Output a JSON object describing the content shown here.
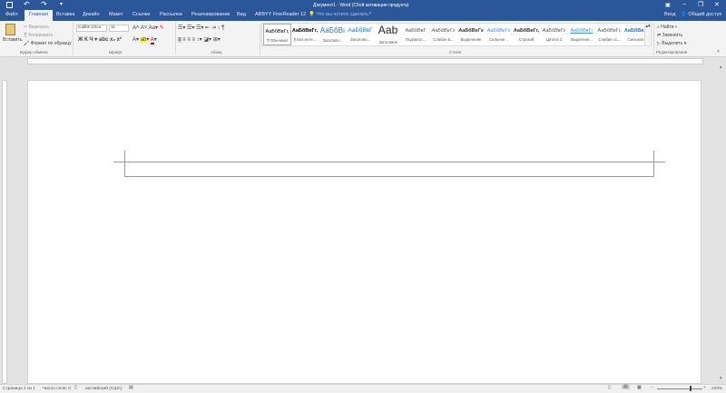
{
  "title": "Документ1 - Word (Сбой активации продукта)",
  "window": {
    "signin": "Вход",
    "share": "Общий доступ"
  },
  "tabs": [
    "Файл",
    "Главная",
    "Вставка",
    "Дизайн",
    "Макет",
    "Ссылки",
    "Рассылки",
    "Рецензирование",
    "Вид",
    "ABBYY FineReader 12"
  ],
  "tell_me": "Что вы хотите сделать?",
  "clipboard": {
    "paste": "Вставить",
    "cut": "Вырезать",
    "copy": "Копировать",
    "format_painter": "Формат по образцу",
    "label": "Буфер обмена"
  },
  "font": {
    "name": "Calibri (Осн",
    "size": "11",
    "label": "Шрифт"
  },
  "paragraph": {
    "label": "Абзац"
  },
  "styles": {
    "label": "Стили",
    "items": [
      {
        "preview": "АаБбВвГг,",
        "name": "¶ Обычный"
      },
      {
        "preview": "АаБбВвГг,",
        "name": "¶ Без инте..."
      },
      {
        "preview": "АаБбВı",
        "name": "Заголово..."
      },
      {
        "preview": "АаБбВвГ",
        "name": "Заголово..."
      },
      {
        "preview": "Ааb",
        "name": "Заголовок"
      },
      {
        "preview": "АаБбВвГ",
        "name": "Подзагол..."
      },
      {
        "preview": "АаБбВеГг",
        "name": "Слабое в..."
      },
      {
        "preview": "АаБбВеГг",
        "name": "Выделение"
      },
      {
        "preview": "АаБбВеГг",
        "name": "Сильное..."
      },
      {
        "preview": "АаБбВвГг,",
        "name": "Строгий"
      },
      {
        "preview": "АаБбВвГг",
        "name": "Цитата 2"
      },
      {
        "preview": "АаБбВвГг",
        "name": "Выделенн..."
      },
      {
        "preview": "АаБбВвГг,",
        "name": "Слабая сс..."
      },
      {
        "preview": "АаБбВвГг,",
        "name": "Сильная..."
      }
    ]
  },
  "editing": {
    "find": "Найти",
    "replace": "Заменить",
    "select": "Выделить",
    "label": "Редактирование"
  },
  "status": {
    "page": "Страница 1 из 1",
    "words": "Число слов: 0",
    "language": "английский (США)",
    "zoom": "225%"
  },
  "colors": {
    "brand": "#2b579a"
  }
}
